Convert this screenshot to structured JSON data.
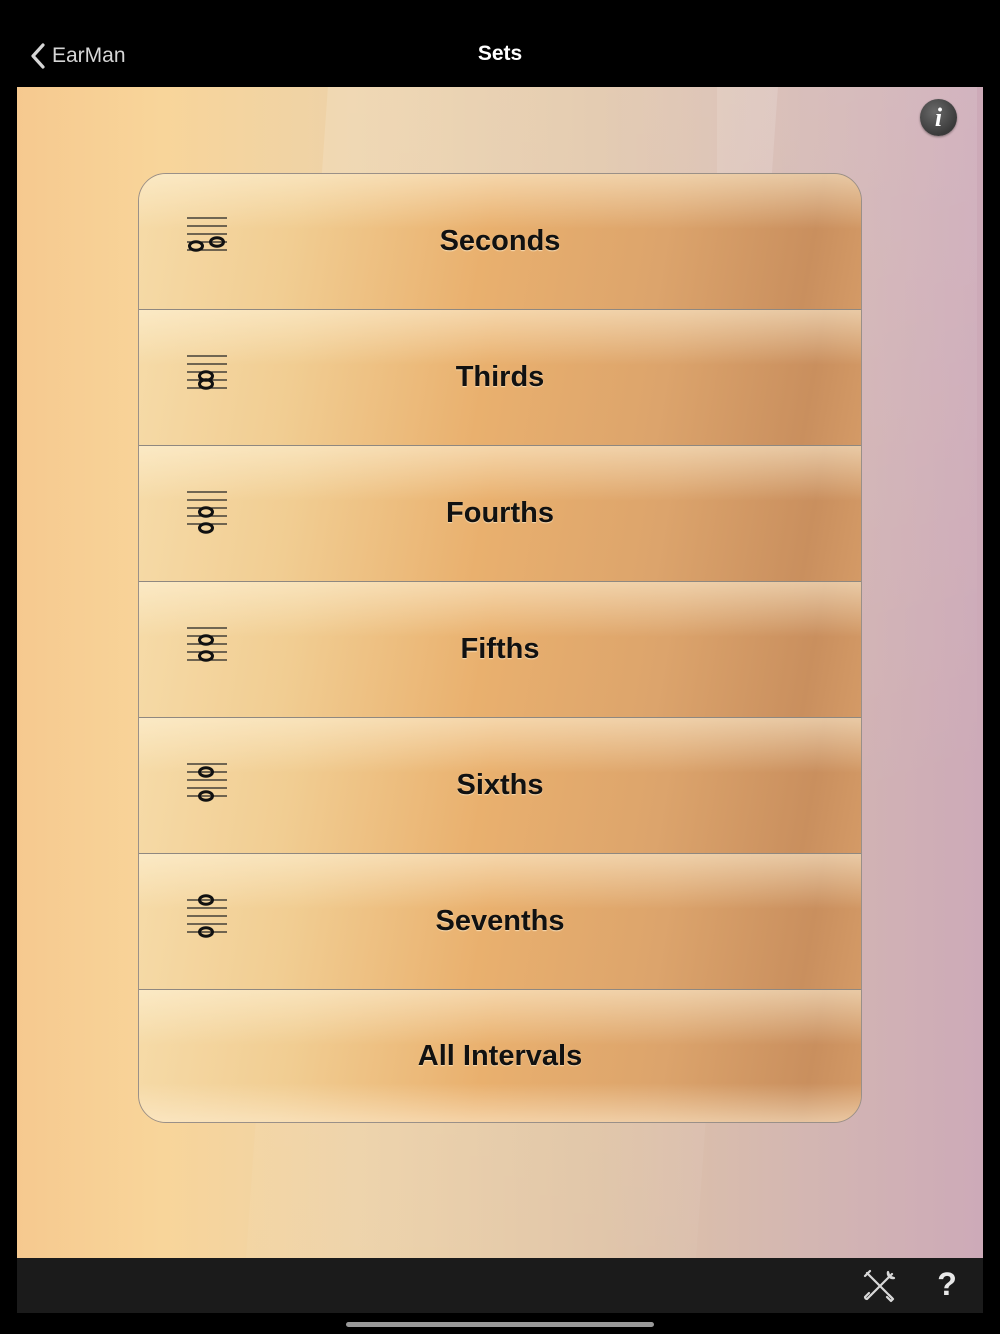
{
  "nav": {
    "back_label": "EarMan",
    "title": "Sets"
  },
  "info_button": {
    "label": "i"
  },
  "sets": [
    {
      "label": "Seconds",
      "icon": "second-interval-notation-icon"
    },
    {
      "label": "Thirds",
      "icon": "third-interval-notation-icon"
    },
    {
      "label": "Fourths",
      "icon": "fourth-interval-notation-icon"
    },
    {
      "label": "Fifths",
      "icon": "fifth-interval-notation-icon"
    },
    {
      "label": "Sixths",
      "icon": "sixth-interval-notation-icon"
    },
    {
      "label": "Sevenths",
      "icon": "seventh-interval-notation-icon"
    },
    {
      "label": "All Intervals",
      "icon": ""
    }
  ],
  "toolbar": {
    "tools_icon": "wrench-screwdriver-icon",
    "help_label": "?"
  }
}
